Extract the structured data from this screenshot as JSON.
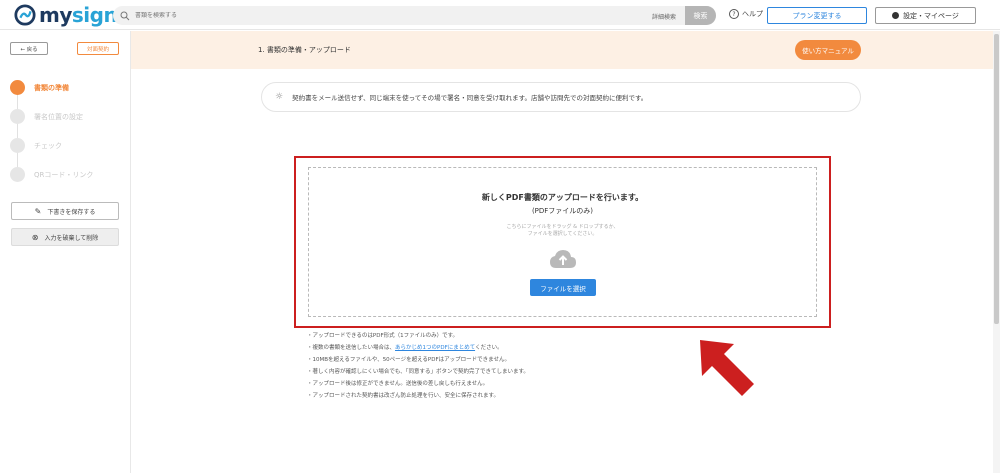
{
  "brand": {
    "name_a": "my",
    "name_b": "sign",
    "logo_color": "#1e3a5f",
    "logo_accent": "#29a3d6"
  },
  "header": {
    "search_placeholder": "書類を検索する",
    "advanced_search": "詳細検索",
    "search_button": "検索",
    "help": "ヘルプ",
    "plan_button": "プラン変更する",
    "settings_button": "設定・マイページ"
  },
  "sidebar": {
    "back": "← 戻る",
    "mode_badge": "対面契約",
    "steps": [
      {
        "label": "書類の準備",
        "active": true
      },
      {
        "label": "署名位置の設定",
        "active": false
      },
      {
        "label": "チェック",
        "active": false
      },
      {
        "label": "QRコード・リンク",
        "active": false
      }
    ],
    "save_draft": "下書きを保存する",
    "discard": "入力を破棄して削除"
  },
  "main": {
    "title": "1. 書類の準備・アップロード",
    "manual_button": "使い方マニュアル",
    "tip": "契約書をメール送信せず、同じ端末を使ってその場で署名・同意を受け取れます。店舗や訪問先での対面契約に便利です。"
  },
  "upload": {
    "title": "新しくPDF書類のアップロードを行います。",
    "subtitle": "(PDFファイルのみ)",
    "hint_line1": "こちらにファイルをドラッグ & ドロップするか、",
    "hint_line2": "ファイルを選択してください。",
    "select_button": "ファイルを選択"
  },
  "notes": {
    "n1": "・アップロードできるのはPDF形式（1ファイルのみ）です。",
    "n2_prefix": "・複数の書類を送信したい場合は、",
    "n2_link": "あらかじめ1つのPDFにまとめて",
    "n2_suffix": "ください。",
    "n3": "・10MBを超えるファイルや、50ページを超えるPDFはアップロードできません。",
    "n4": "・著しく内容が確認しにくい場合でも、「同意する」ボタンで契約完了できてしまいます。",
    "n5": "・アップロード後は修正ができません。送信後の差し戻しも行えません。",
    "n6": "・アップロードされた契約書は改ざん防止処理を行い、安全に保存されます。"
  },
  "colors": {
    "accent_orange": "#f28a3e",
    "primary_blue": "#2e86de",
    "highlight_red": "#cc1f1f"
  },
  "icons": [
    "search-icon",
    "help-icon",
    "user-icon",
    "pencil-icon",
    "circle-x-icon",
    "lightbulb-icon",
    "cloud-upload-icon",
    "arrow-annotation-icon"
  ]
}
